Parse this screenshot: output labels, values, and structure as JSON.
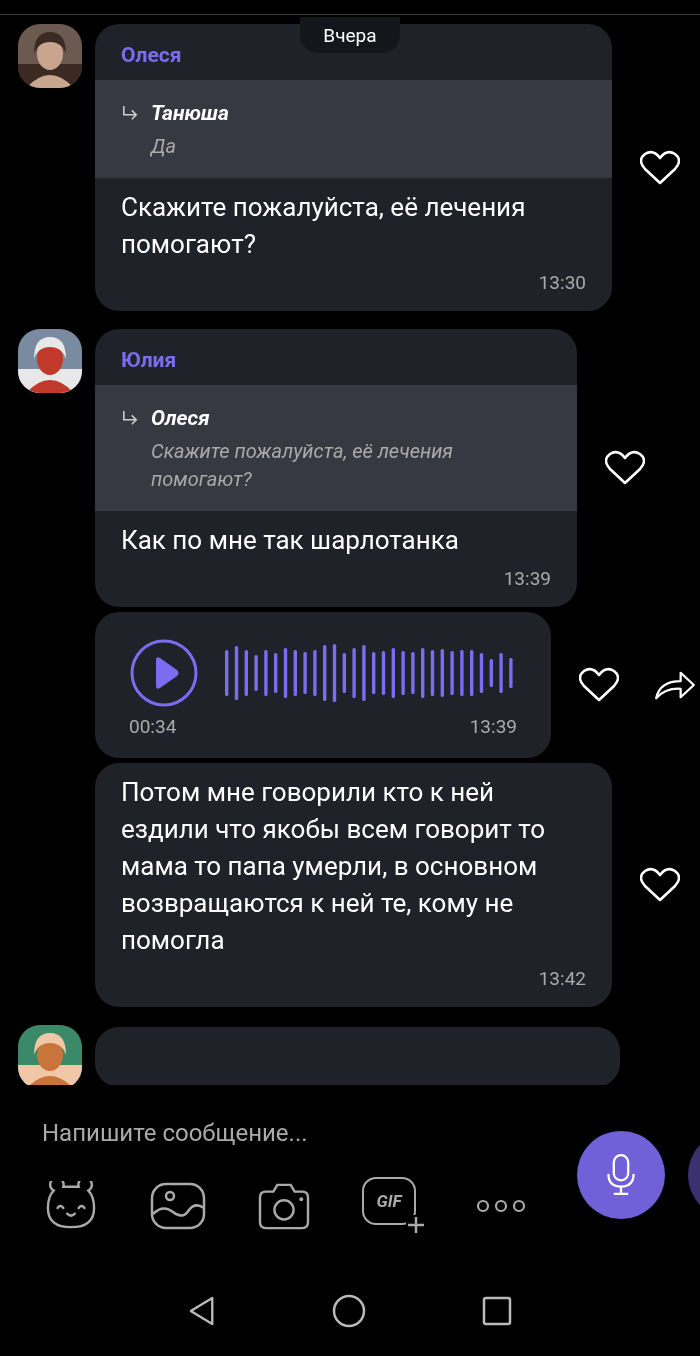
{
  "date_separator": "Вчера",
  "messages": [
    {
      "kind": "text",
      "sender": "Олеся",
      "reply": {
        "sender": "Танюша",
        "text": "Да"
      },
      "text": "Скажите пожалуйста, её лечения помогают?",
      "time": "13:30",
      "liked": false
    },
    {
      "kind": "text",
      "sender": "Юлия",
      "reply": {
        "sender": "Олеся",
        "text": "Скажите пожалуйста, её лечения помогают?"
      },
      "text": "Как по мне так шарлотанка",
      "time": "13:39",
      "liked": false
    },
    {
      "kind": "voice",
      "duration": "00:34",
      "time": "13:39",
      "liked": false,
      "share": true
    },
    {
      "kind": "text",
      "text": "Потом мне говорили кто к ней ездили что якобы всем говорит то мама то папа умерли, в основном возвращаются к ней те, кому не помогла",
      "time": "13:42",
      "liked": false
    },
    {
      "kind": "cut"
    }
  ],
  "composer": {
    "placeholder": "Напишите сообщение...",
    "gif_label": "GIF"
  }
}
